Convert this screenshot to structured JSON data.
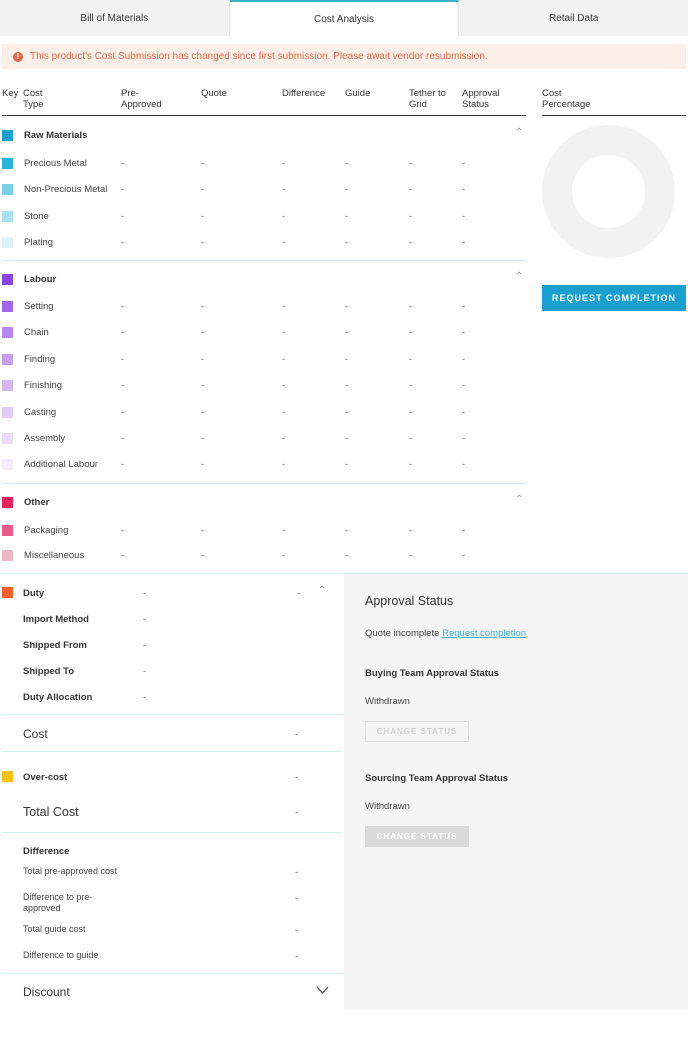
{
  "tabs": [
    {
      "label": "Bill of Materials"
    },
    {
      "label": "Cost Analysis"
    },
    {
      "label": "Retail Data"
    }
  ],
  "alert": {
    "icon": "!",
    "text": "This product's Cost Submission has changed since first submission. Please await vendor resubmission."
  },
  "columns": {
    "key": "Key",
    "cost_type": "Cost Type",
    "pre_approved": "Pre-Approved",
    "quote": "Quote",
    "difference": "Difference",
    "guide": "Guide",
    "tether": "Tether to Grid",
    "approval": "Approval Status",
    "percentage": "Cost Percentage"
  },
  "dash": "-",
  "groups": [
    {
      "name": "Raw Materials",
      "color": "#1a9fd0",
      "items": [
        {
          "name": "Precious Metal",
          "color": "#2bb3d8"
        },
        {
          "name": "Non-Precious Metal",
          "color": "#7ccfea"
        },
        {
          "name": "Stone",
          "color": "#a8e1f2"
        },
        {
          "name": "Plating",
          "color": "#dcf3fa"
        }
      ]
    },
    {
      "name": "Labour",
      "color": "#8e44e0",
      "items": [
        {
          "name": "Setting",
          "color": "#a366e8"
        },
        {
          "name": "Chain",
          "color": "#b888ec"
        },
        {
          "name": "Finding",
          "color": "#c7a0ef"
        },
        {
          "name": "Finishing",
          "color": "#d4b6f2"
        },
        {
          "name": "Casting",
          "color": "#e0ccf6"
        },
        {
          "name": "Assembly",
          "color": "#eadcf9"
        },
        {
          "name": "Additional Labour",
          "color": "#f3ecfb"
        }
      ]
    },
    {
      "name": "Other",
      "color": "#e0245e",
      "items": [
        {
          "name": "Packaging",
          "color": "#e85a8a"
        },
        {
          "name": "Miscellaneous",
          "color": "#f2b6c9"
        }
      ]
    }
  ],
  "request_completion_label": "REQUEST COMPLETION",
  "duty": {
    "label": "Duty",
    "value": "-",
    "color": "#f2622e",
    "rows": [
      {
        "label": "Import Method",
        "value": "-"
      },
      {
        "label": "Shipped From",
        "value": "-"
      },
      {
        "label": "Shipped To",
        "value": "-"
      },
      {
        "label": "Duty Allocation",
        "value": "-"
      }
    ]
  },
  "cost": {
    "label": "Cost",
    "value": "-"
  },
  "over_cost": {
    "label": "Over-cost",
    "value": "-",
    "color": "#f7c21a"
  },
  "total_cost": {
    "label": "Total Cost",
    "value": "-"
  },
  "difference": {
    "label": "Difference",
    "rows": [
      {
        "label": "Total pre-approved cost",
        "value": "-"
      },
      {
        "label": "Difference to pre-approved",
        "value": "-"
      },
      {
        "label": "Total guide cost",
        "value": "-"
      },
      {
        "label": "Difference to guide",
        "value": "-"
      }
    ]
  },
  "discount": {
    "label": "Discount"
  },
  "approval": {
    "title": "Approval Status",
    "quote_status": "Quote incomplete",
    "request_link": "Request completion",
    "buying_head": "Buying Team Approval Status",
    "buying_status": "Withdrawn",
    "buying_button": "CHANGE STATUS",
    "sourcing_head": "Sourcing Team Approval Status",
    "sourcing_status": "Withdrawn",
    "sourcing_button": "CHANGE STATUS"
  }
}
